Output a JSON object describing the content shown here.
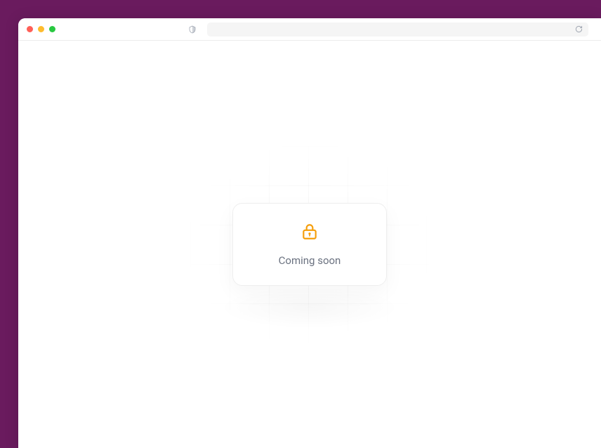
{
  "card": {
    "message": "Coming soon"
  },
  "colors": {
    "accent": "#f59e0b",
    "pageBackground": "#6a1b5e"
  }
}
